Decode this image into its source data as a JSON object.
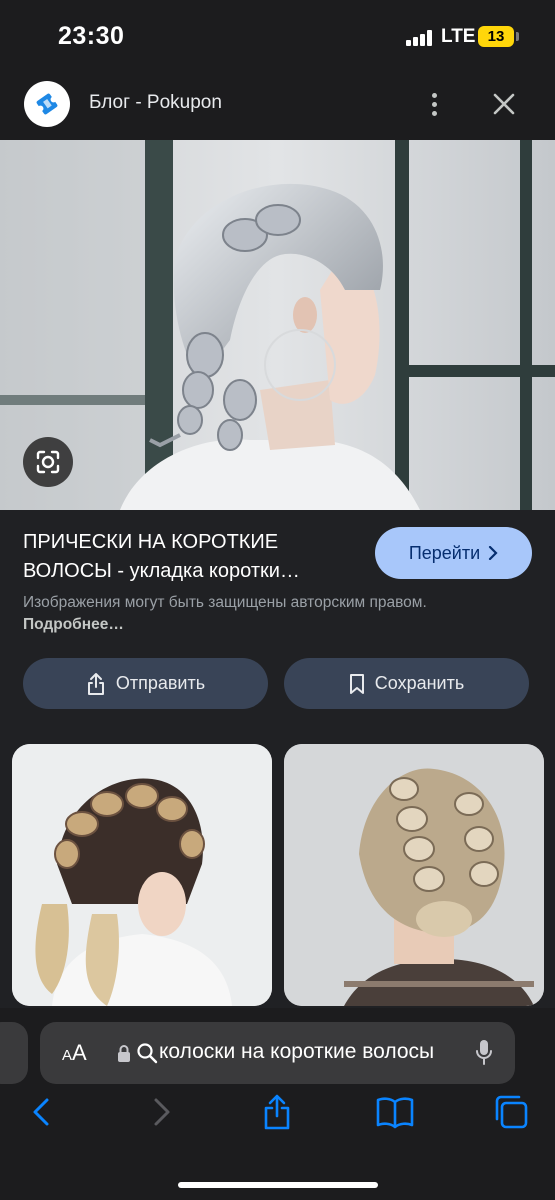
{
  "status_bar": {
    "time": "23:30",
    "network": "LTE",
    "battery": "13"
  },
  "header": {
    "site_name": "Блог - Pokupon",
    "logo_icon": "pokupon-ticket-icon"
  },
  "result": {
    "title": "ПРИЧЕСКИ НА КОРОТКИЕ\nВОЛОСЫ - укладка коротки…",
    "go_label": "Перейти",
    "copyright_text": "Изображения могут быть защищены авторским правом.",
    "more_label": "Подробнее…"
  },
  "actions": {
    "share_label": "Отправить",
    "save_label": "Сохранить"
  },
  "address_bar": {
    "aa_label_small": "A",
    "aa_label_big": "A",
    "query": "колоски на короткие волосы"
  },
  "colors": {
    "accent_button": "#a8c7fa",
    "pill_button": "#394457",
    "ios_blue": "#0a84ff",
    "battery_yellow": "#ffd60a"
  }
}
